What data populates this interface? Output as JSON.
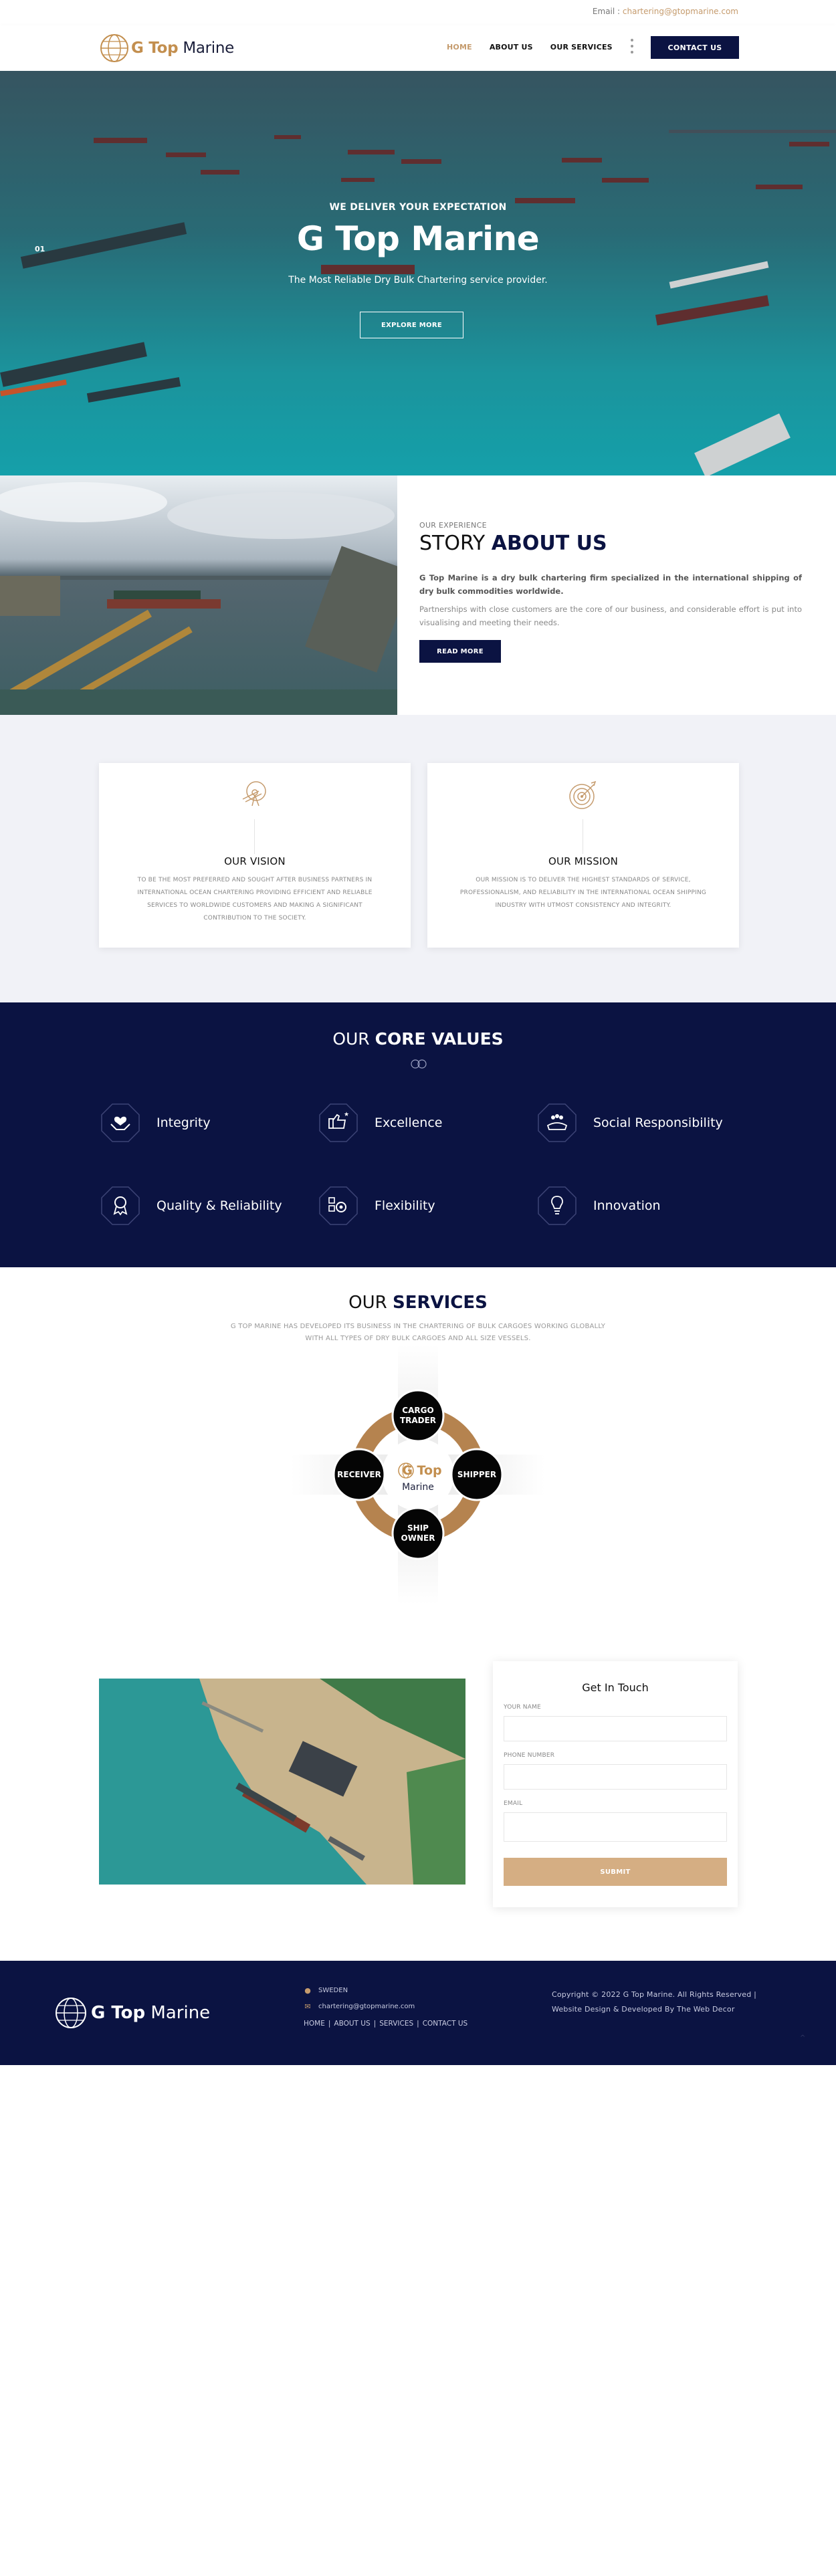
{
  "topbar": {
    "email_label": "Email :",
    "email_value": "chartering@gtopmarine.com"
  },
  "header": {
    "logo": {
      "word1": "G Top",
      "word2": "Marine"
    },
    "nav": [
      {
        "label": "HOME",
        "active": true
      },
      {
        "label": "ABOUT US",
        "active": false
      },
      {
        "label": "OUR SERVICES",
        "active": false
      }
    ],
    "contact_button": "CONTACT US"
  },
  "hero": {
    "pretitle": "WE DELIVER YOUR EXPECTATION",
    "title": "G Top Marine",
    "subtitle": "The Most Reliable Dry Bulk Chartering service provider.",
    "button": "EXPLORE MORE",
    "slide_indicator": "01"
  },
  "about": {
    "eyebrow": "OUR EXPERIENCE",
    "title_light": "STORY",
    "title_bold": "ABOUT US",
    "lead": "G Top Marine is a dry bulk chartering firm specialized in the international shipping of dry bulk commodities worldwide.",
    "paragraph": "Partnerships with close customers are the core of our business, and considerable effort is put into visualising and meeting their needs.",
    "button": "READ MORE"
  },
  "vision": {
    "title": "OUR VISION",
    "text": "TO BE THE MOST PREFERRED AND SOUGHT AFTER BUSINESS PARTNERS IN INTERNATIONAL OCEAN CHARTERING PROVIDING EFFICIENT AND RELIABLE SERVICES TO WORLDWIDE CUSTOMERS AND MAKING A SIGNIFICANT CONTRIBUTION TO THE SOCIETY."
  },
  "mission": {
    "title": "OUR MISSION",
    "text": "OUR MISSION IS TO DELIVER THE HIGHEST STANDARDS OF SERVICE, PROFESSIONALISM, AND RELIABILITY IN THE INTERNATIONAL OCEAN SHIPPING INDUSTRY WITH UTMOST CONSISTENCY AND INTEGRITY."
  },
  "core_values": {
    "title_light": "OUR",
    "title_bold": "CORE VALUES",
    "items": [
      {
        "label": "Integrity",
        "icon": "hands-heart-icon"
      },
      {
        "label": "Excellence",
        "icon": "thumbs-up-stars-icon"
      },
      {
        "label": "Social Responsibility",
        "icon": "community-hands-icon"
      },
      {
        "label": "Quality & Reliability",
        "icon": "award-ribbon-icon"
      },
      {
        "label": "Flexibility",
        "icon": "gears-flex-icon"
      },
      {
        "label": "Innovation",
        "icon": "lightbulb-icon"
      }
    ]
  },
  "services": {
    "title_light": "OUR",
    "title_bold": "SERVICES",
    "description": "G TOP MARINE HAS DEVELOPED ITS BUSINESS IN THE CHARTERING OF BULK CARGOES WORKING GLOBALLY WITH ALL TYPES OF DRY BULK CARGOES AND ALL SIZE VESSELS.",
    "diagram": {
      "center_word1": "G Top",
      "center_word2": "Marine",
      "top": [
        "CARGO",
        "TRADER"
      ],
      "left": [
        "RECEIVER"
      ],
      "right": [
        "SHIPPER"
      ],
      "bottom": [
        "SHIP",
        "OWNER"
      ]
    }
  },
  "contact_form": {
    "title": "Get In Touch",
    "name_label": "YOUR NAME",
    "phone_label": "PHONE NUMBER",
    "email_label": "EMAIL",
    "name_value": "",
    "phone_value": "",
    "email_value": "",
    "submit": "SUBMIT"
  },
  "footer": {
    "logo": {
      "word1": "G Top",
      "word2": "Marine"
    },
    "location": "SWEDEN",
    "email": "chartering@gtopmarine.com",
    "links": [
      "HOME",
      "ABOUT US",
      "SERVICES",
      "CONTACT US"
    ],
    "copyright": "Copyright © 2022 G Top Marine. All Rights Reserved | Website Design & Developed By The Web Decor"
  },
  "colors": {
    "navy": "#0b1342",
    "gold": "#c59b6d",
    "brown_ring": "#b5834f",
    "light_bg": "#f1f2f7"
  }
}
